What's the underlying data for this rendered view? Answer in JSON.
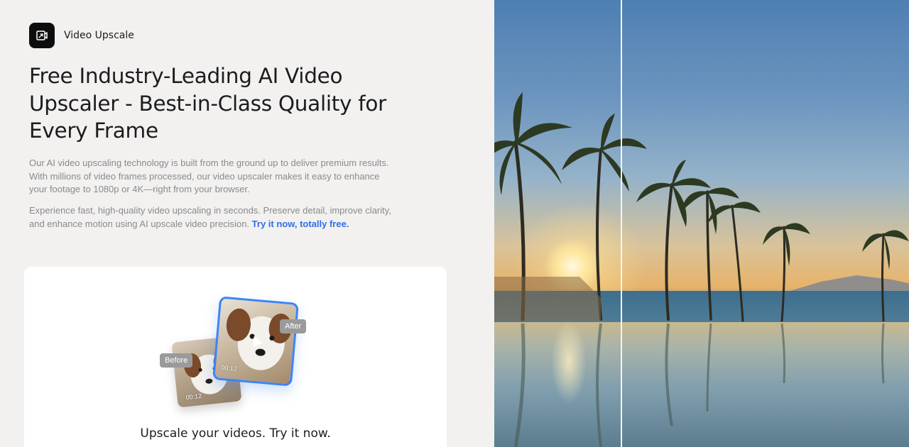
{
  "brand": {
    "name": "Video Upscale",
    "logo_icon": "upscale-icon"
  },
  "hero": {
    "title": "Free Industry-Leading AI Video Upscaler - Best-in-Class Quality for Every Frame",
    "paragraph1": "Our AI video upscaling technology is built from the ground up to deliver premium results. With millions of video frames processed, our video upscaler makes it easy to enhance your footage to 1080p or 4K—right from your browser.",
    "paragraph2_text": "Experience fast, high-quality video upscaling in seconds. Preserve detail, improve clarity, and enhance motion using AI upscale video precision.",
    "paragraph2_link": "Try it now, totally free."
  },
  "upload_card": {
    "before_label": "Before",
    "after_label": "After",
    "before_time": "00:12",
    "after_time": "00:12",
    "cta_text": "Upscale your videos. Try it now.",
    "play_icon": "play-icon"
  },
  "comparison": {
    "divider_icon": "compare-slider-handle"
  },
  "colors": {
    "accent": "#2f6ee8",
    "frame_blue": "#3d84f5",
    "background": "#f2f1ef"
  }
}
